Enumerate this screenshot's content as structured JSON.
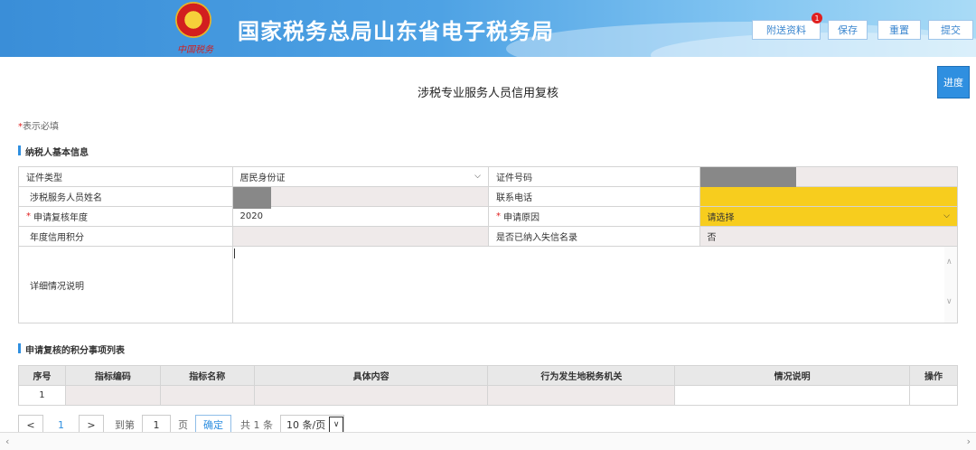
{
  "header": {
    "brand": "国家税务总局山东省电子税务局",
    "emblem_caption": "中国税务",
    "buttons": {
      "attach": "附送资料",
      "attach_badge": "1",
      "save": "保存",
      "reset": "重置",
      "submit": "提交"
    },
    "progress": "进度"
  },
  "page": {
    "title": "涉税专业服务人员信用复核",
    "required_note_star": "*",
    "required_note": "表示必填"
  },
  "basic_info": {
    "section_title": "纳税人基本信息",
    "id_type_label": "证件类型",
    "id_type_value": "居民身份证",
    "id_number_label": "证件号码",
    "name_label": "涉税服务人员姓名",
    "phone_label": "联系电话",
    "year_label": "申请复核年度",
    "year_value": "2020",
    "reason_label": "申请原因",
    "reason_placeholder": "请选择",
    "credit_label": "年度信用积分",
    "blacklist_label": "是否已纳入失信名录",
    "blacklist_value": "否",
    "detail_label": "详细情况说明",
    "required_star": "*"
  },
  "list": {
    "section_title": "申请复核的积分事项列表",
    "columns": [
      "序号",
      "指标编码",
      "指标名称",
      "具体内容",
      "行为发生地税务机关",
      "情况说明",
      "操作"
    ],
    "rows": [
      {
        "index": "1"
      }
    ]
  },
  "pager": {
    "prev": "<",
    "page": "1",
    "next": ">",
    "goto_label": "到第",
    "goto_value": "1",
    "page_unit": "页",
    "confirm": "确定",
    "total": "共 1 条",
    "page_size": "10 条/页"
  },
  "colors": {
    "accent": "#2f8fe0",
    "required": "#e02020",
    "highlight": "#f7cd1e",
    "readonly": "#efeaea"
  }
}
